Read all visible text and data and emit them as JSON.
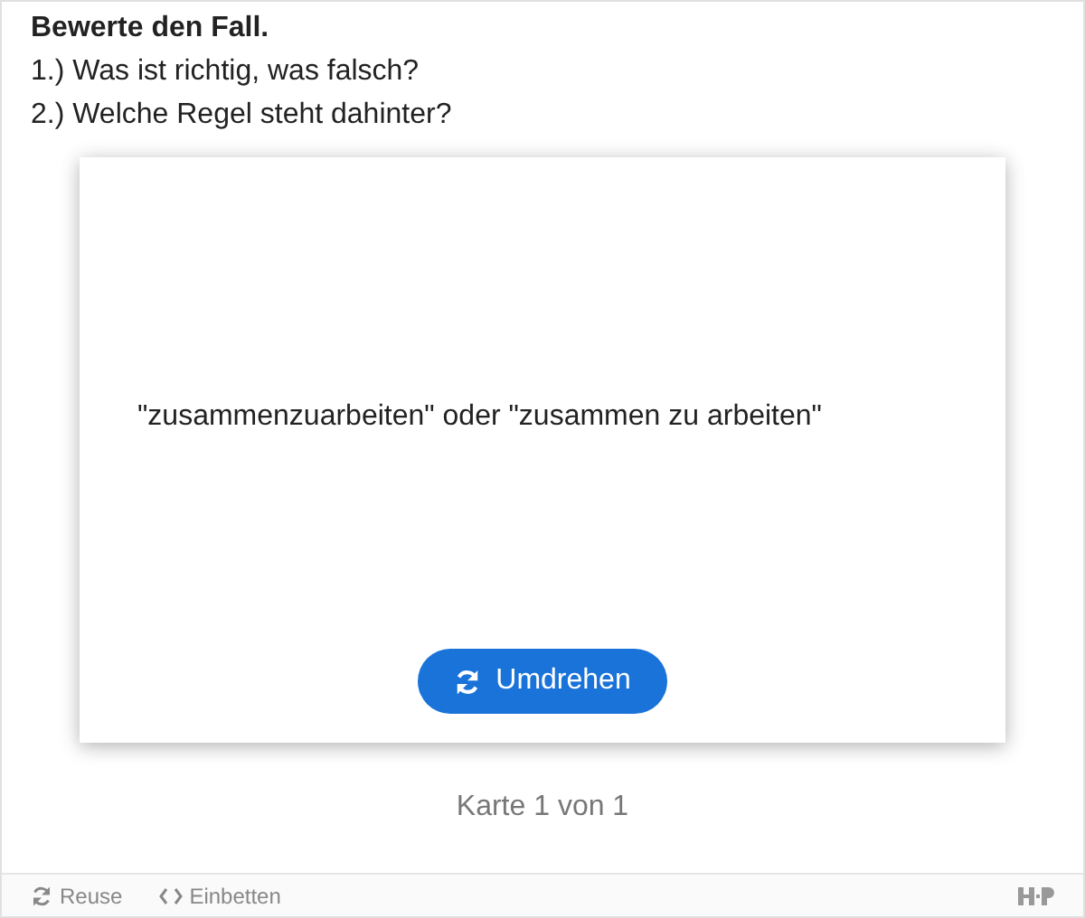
{
  "task": {
    "title": "Bewerte den Fall.",
    "lines": [
      "1.) Was ist richtig, was falsch?",
      "2.) Welche Regel steht dahinter?"
    ]
  },
  "card": {
    "text": "\"zusammenzuarbeiten\" oder \"zusammen zu arbeiten\"",
    "button": "Umdrehen"
  },
  "progress": "Karte 1 von 1",
  "footer": {
    "actions": [
      {
        "kind": "reuse",
        "label": "Reuse"
      },
      {
        "kind": "embed",
        "label": "Einbetten"
      }
    ]
  }
}
